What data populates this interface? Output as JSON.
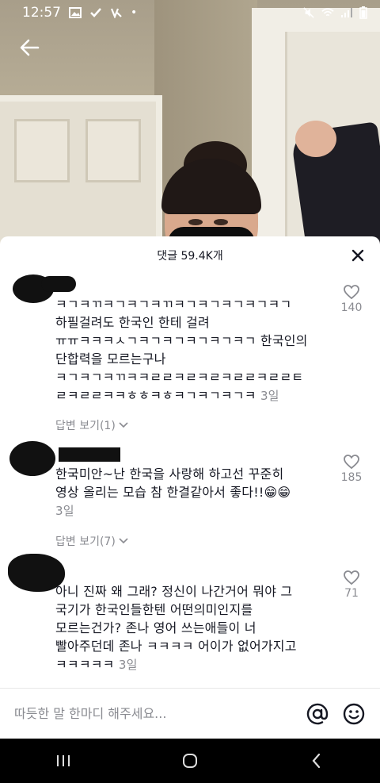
{
  "status_bar": {
    "time": "12:57"
  },
  "sheet": {
    "title": "댓글 59.4K개"
  },
  "comments": [
    {
      "text": "ㅋㄱㅋㄲㅋㄱㅋㄱㅋㄲㅋㄱㅋㄱㅋㄱㅋㄱㅋㄱ\n하필걸려도 한국인 한테 걸려\nㅠㅠㅋㅋㅋㅅㄱㅋㄱㅋㄱㅋㄱㅋㄱㅋㄱ 한국인의\n단합력을 모르는구나\nㅋㄱㅋㄱㅋㄲㅋㅋㄹㄹㅋㄹㅋㄹㅋㄹㄹㅋㄹㄹㅌ\nㄹㅋㄹㄹㅋㅋㅎㅎㅋㅎㅋㄱㅋㄱㅋㄱㅋ",
      "time": "3일",
      "likes": "140",
      "reply_label": "답변 보기(1)"
    },
    {
      "text": "한국미안~난 한국을 사랑해 하고선 꾸준히\n영상 올리는 모습 참 한결같아서 좋다!!😁😁",
      "time": "3일",
      "likes": "185",
      "reply_label": "답변 보기(7)"
    },
    {
      "text": "아니 진짜 왜 그래? 정신이 나간거어 뭐야 그\n국기가 한국인들한텐 어떤의미인지를\n모르는건가? 존나 영어 쓰는애들이 너\n빨아주던데 존나 ㅋㅋㅋㅋ 어이가 없어가지고\nㅋㅋㅋㅋㅋ",
      "time": "3일",
      "likes": "71"
    }
  ],
  "input": {
    "placeholder": "따듯한 말 한마디 해주세요..."
  },
  "icons": {
    "back": "back-arrow-icon",
    "close": "close-icon",
    "heart": "heart-icon",
    "mention": "at-sign-icon",
    "emoji": "smiley-icon"
  },
  "colors": {
    "text": "#161823",
    "secondary": "#8a8b91",
    "sheet": "#ffffff"
  }
}
